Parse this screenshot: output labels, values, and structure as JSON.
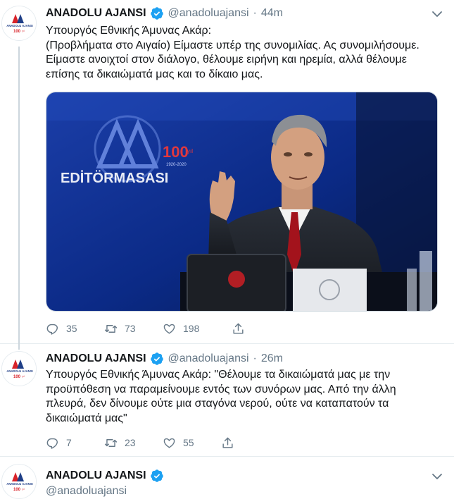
{
  "account": {
    "name": "ANADOLU AJANSI",
    "handle": "@anadoluajansi",
    "logo_text_top": "ANADOLU AJANSI",
    "logo_text_badge": "100",
    "logo_text_suffix": "yıl"
  },
  "colors": {
    "verified": "#1da1f2",
    "muted": "#657786",
    "text": "#14171a",
    "border": "#e6ecf0",
    "logo_red": "#d8232a",
    "logo_blue": "#1f3f87"
  },
  "tweets": [
    {
      "time": "44m",
      "lines": [
        "Υπουργός Εθνικής Άμυνας Ακάρ:",
        "(Προβλήματα στο Αιγαίο) Είμαστε υπέρ της συνομιλίας. Ας συνομιλήσουμε.",
        "Είμαστε ανοιχτοί στον διάλογο, θέλουμε ειρήνη και ηρεμία, αλλά θέλουμε",
        "επίσης τα δικαιώματά μας και το δίκαιο μας."
      ],
      "media": {
        "backdrop_title": "EDİTÖRMASASI",
        "backdrop_badge": "100",
        "backdrop_years": "1920-2020",
        "backdrop_suffix": "yıl"
      },
      "replies": "35",
      "retweets": "73",
      "likes": "198"
    },
    {
      "time": "26m",
      "lines": [
        "Υπουργός Εθνικής Άμυνας Ακάρ: \"Θέλουμε τα δικαιώματά μας με την",
        "προϋπόθεση να παραμείνουμε εντός των συνόρων μας. Από την άλλη",
        "πλευρά, δεν δίνουμε ούτε μια σταγόνα νερού, ούτε να καταπατούν τα",
        "δικαιώματά μας\""
      ],
      "replies": "7",
      "retweets": "23",
      "likes": "55"
    },
    {
      "time": ""
    }
  ],
  "separator": "·",
  "icons": [
    "reply-icon",
    "retweet-icon",
    "like-icon",
    "share-icon",
    "verified-icon",
    "chevron-down-icon"
  ]
}
